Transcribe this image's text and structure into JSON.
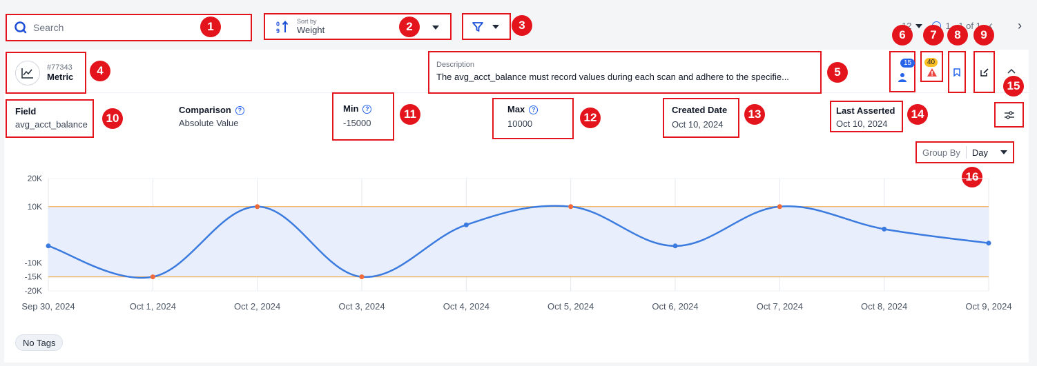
{
  "search": {
    "placeholder": "Search"
  },
  "sort": {
    "caption": "Sort by",
    "value": "Weight"
  },
  "pager": {
    "per_page": "12",
    "range": "1 - 1 of 1"
  },
  "check": {
    "id": "#77343",
    "type": "Metric",
    "description_label": "Description",
    "description": "The avg_acct_balance must record values during each scan and adhere to the specifie...",
    "assignee_count": "15",
    "anomaly_count": "40"
  },
  "fields": {
    "field_label": "Field",
    "field_value": "avg_acct_balance",
    "comparison_label": "Comparison",
    "comparison_value": "Absolute Value",
    "min_label": "Min",
    "min_value": "-15000",
    "max_label": "Max",
    "max_value": "10000",
    "created_label": "Created Date",
    "created_value": "Oct 10, 2024",
    "asserted_label": "Last Asserted",
    "asserted_value": "Oct 10, 2024"
  },
  "group_by": {
    "label": "Group By",
    "value": "Day"
  },
  "tags": {
    "empty_label": "No Tags"
  },
  "callouts": [
    "1",
    "2",
    "3",
    "4",
    "5",
    "6",
    "7",
    "8",
    "9",
    "10",
    "11",
    "12",
    "13",
    "14",
    "15",
    "16"
  ],
  "colors": {
    "accent": "#2563eb",
    "line": "#3b7be0",
    "threshold": "#f0b25a",
    "band": "#e8eefb",
    "callout": "#e3141b",
    "warning": "#f59e0b"
  },
  "chart_data": {
    "type": "line",
    "categories": [
      "Sep 30, 2024",
      "Oct 1, 2024",
      "Oct 2, 2024",
      "Oct 3, 2024",
      "Oct 4, 2024",
      "Oct 5, 2024",
      "Oct 6, 2024",
      "Oct 7, 2024",
      "Oct 8, 2024",
      "Oct 9, 2024"
    ],
    "values": [
      -4000,
      -15000,
      10000,
      -15000,
      3500,
      10000,
      -4000,
      10000,
      2000,
      -3000
    ],
    "y_ticks": [
      {
        "value": 20000,
        "label": "20K"
      },
      {
        "value": 10000,
        "label": "10K"
      },
      {
        "value": -10000,
        "label": "-10K"
      },
      {
        "value": -15000,
        "label": "-15K"
      },
      {
        "value": -20000,
        "label": "-20K"
      }
    ],
    "ylim": [
      -20000,
      20000
    ],
    "min_threshold": -15000,
    "max_threshold": 10000,
    "grid": true
  }
}
